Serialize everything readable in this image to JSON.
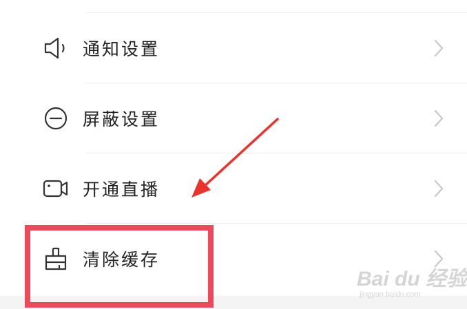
{
  "menu": {
    "items": [
      {
        "label": "通知设置",
        "icon": "speaker-icon"
      },
      {
        "label": "屏蔽设置",
        "icon": "block-icon"
      },
      {
        "label": "开通直播",
        "icon": "video-camera-icon"
      },
      {
        "label": "清除缓存",
        "icon": "brush-icon"
      }
    ]
  },
  "annotation": {
    "highlight_color": "#ec4a5c",
    "arrow_color": "#e8342c"
  },
  "watermark": {
    "main": "Bai du 经验",
    "sub": "jingyan.baidu.com"
  },
  "colors": {
    "label": "#222222",
    "icon": "#333333",
    "chevron": "#c8c8c8",
    "divider": "#efefef"
  }
}
